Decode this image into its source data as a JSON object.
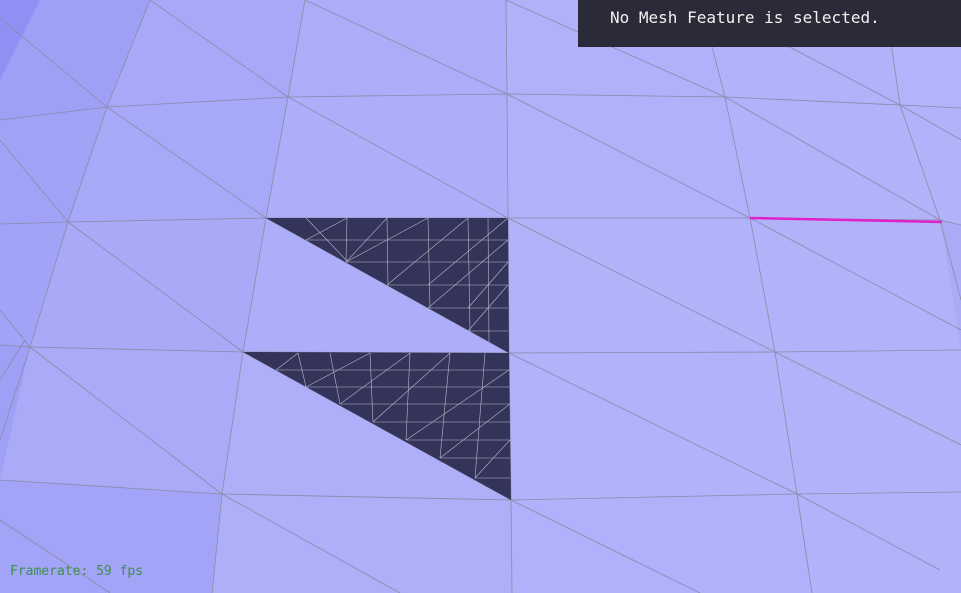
{
  "status": {
    "message": "No Mesh Feature is selected."
  },
  "framerate": {
    "text": "Framerate: 59 fps"
  },
  "colors": {
    "face": "#abadf9",
    "face_dark_side": "#9a9cf5",
    "selected_face": "#34345a",
    "edge": "#8a8aa6",
    "highlight_edge": "#e020c8",
    "panel_background": "#2b2a38",
    "framerate_text": "#3d8f4a"
  }
}
